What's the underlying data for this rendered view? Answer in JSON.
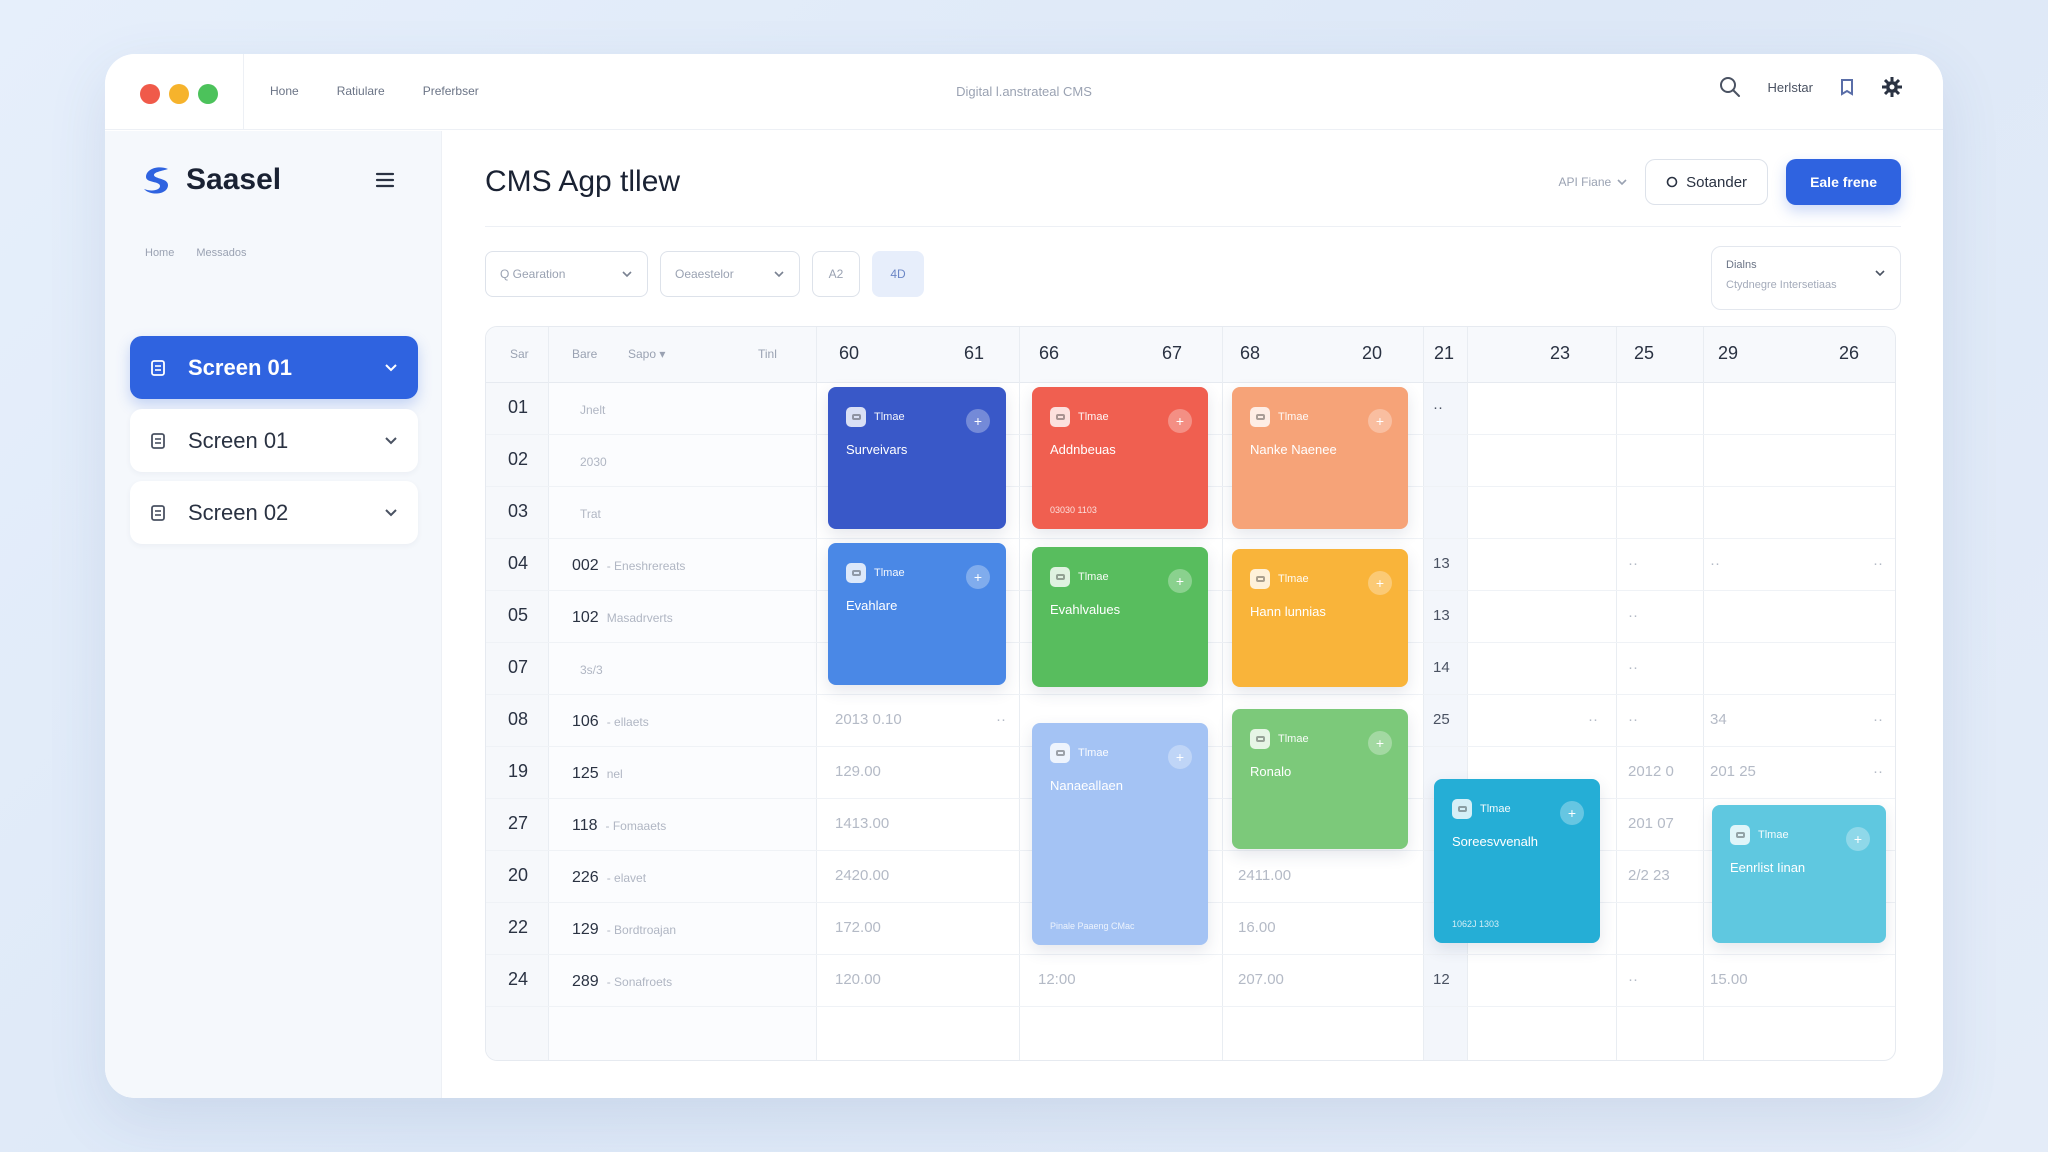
{
  "colors": {
    "accent": "#2f63e0",
    "red": "#f05f50",
    "green": "#58bd5e",
    "orange": "#f6a378",
    "yellow": "#f9b43a",
    "teal": "#25aed6",
    "cyan": "#5fc8e0",
    "light_blue": "#a4c3f4",
    "grass": "#7cc97a"
  },
  "window": {
    "title": "Digital l.anstrateal CMS"
  },
  "topnav": [
    "Hone",
    "Ratiulare",
    "Preferbser"
  ],
  "topbar": {
    "user": "Herlstar",
    "icons": [
      "search-icon",
      "bookmark-icon",
      "settings-gear-icon"
    ]
  },
  "sidebar": {
    "brand": "Saasel",
    "crumbs": [
      "Home",
      "Messados"
    ],
    "items": [
      {
        "label": "Screen 01",
        "active": true
      },
      {
        "label": "Screen 01",
        "active": false
      },
      {
        "label": "Screen 02",
        "active": false
      }
    ]
  },
  "header": {
    "title": "CMS Agp tllew",
    "dropdown_label": "API Fiane",
    "secondary_button": "Sotander",
    "primary_button": "Eale frene"
  },
  "filters": [
    {
      "label": "Q Gearation"
    },
    {
      "label": "Oeaestelor"
    },
    {
      "label": "A2"
    },
    {
      "label": "4D"
    }
  ],
  "view_select": {
    "label": "Dialns",
    "sub": "Ctydnegre Intersetiaas"
  },
  "table": {
    "col_headers": [
      "Sar",
      "Bare",
      "Sapo",
      "Tinl"
    ],
    "date_headers": [
      "60",
      "61",
      "66",
      "67",
      "68",
      "20",
      "21",
      "23",
      "25",
      "29",
      "26"
    ],
    "rows": [
      {
        "n": "01",
        "a": "",
        "b": "Jnelt",
        "c3": "",
        "c5": "",
        "c7": "··",
        "c8": "",
        "c9": "",
        "c10": ""
      },
      {
        "n": "02",
        "a": "",
        "b": "2030",
        "c3": "",
        "c5": "",
        "c7": "",
        "c8": "",
        "c9": "",
        "c10": ""
      },
      {
        "n": "03",
        "a": "",
        "b": "Trat",
        "c3": "",
        "c5": "",
        "c7": "",
        "c8": "",
        "c9": "",
        "c10": ""
      },
      {
        "n": "04",
        "a": "002",
        "b": "- Eneshrereats",
        "c3": "",
        "c5": "",
        "c7": "13",
        "c8": "",
        "c9": "··",
        "c10": "··"
      },
      {
        "n": "05",
        "a": "102",
        "b": "Masadrverts",
        "c3": "",
        "c5": "",
        "c7": "13",
        "c8": "",
        "c9": "··",
        "c10": ""
      },
      {
        "n": "07",
        "a": "",
        "b": "3s/3",
        "c3": "",
        "c5": "",
        "c7": "14",
        "c8": "",
        "c9": "··",
        "c10": ""
      },
      {
        "n": "08",
        "a": "106",
        "b": "- ellaets",
        "c3": "2013 0.10",
        "c5": "",
        "c7": "25",
        "c8": "··",
        "c9": "··",
        "c10": "34"
      },
      {
        "n": "19",
        "a": "125",
        "b": "nel",
        "c3": "129.00",
        "c5": "",
        "c7": "",
        "c8": "",
        "c9": "2012 0",
        "c10": "201 25"
      },
      {
        "n": "27",
        "a": "118",
        "b": "- Fomaaets",
        "c3": "1413.00",
        "c5": "",
        "c7": "",
        "c8": "",
        "c9": "201 07",
        "c10": ""
      },
      {
        "n": "20",
        "a": "226",
        "b": "- elavet",
        "c3": "2420.00",
        "c5": "2411.00",
        "c7": "",
        "c8": "",
        "c9": "2/2 23",
        "c10": ""
      },
      {
        "n": "22",
        "a": "129",
        "b": "- Bordtroajan",
        "c3": "172.00",
        "c5": "16.00",
        "c7": "",
        "c8": "",
        "c9": "",
        "c10": ""
      },
      {
        "n": "24",
        "a": "289",
        "b": "- Sonafroets",
        "c3": "120.00",
        "c4": "12:00",
        "c5": "207.00",
        "c7": "12",
        "c8": "",
        "c9": "··",
        "c10": "15.00"
      }
    ],
    "row_trailing": {
      "r08_c4": "··",
      "r08_c10b": "··",
      "r19_c10b": "··",
      "r04_c10b": "··"
    }
  },
  "cards": [
    {
      "tag": "Tlmae",
      "title": "Surveivars",
      "foot": "",
      "color": "#3958c8"
    },
    {
      "tag": "Tlmae",
      "title": "Addnbeuas",
      "foot": "03030 1103",
      "color": "#f05f50"
    },
    {
      "tag": "Tlmae",
      "title": "Nanke Naenee",
      "foot": "",
      "color": "#f6a378"
    },
    {
      "tag": "Tlmae",
      "title": "Evahlare",
      "foot": "",
      "color": "#4a88e6"
    },
    {
      "tag": "Tlmae",
      "title": "Evahlvalues",
      "foot": "",
      "color": "#58bd5e"
    },
    {
      "tag": "Tlmae",
      "title": "Hann lunnias",
      "foot": "",
      "color": "#f9b43a"
    },
    {
      "tag": "Tlmae",
      "title": "Nanaeallaen",
      "foot": "Pinale Paaeng CMac",
      "color": "#a4c3f4"
    },
    {
      "tag": "Tlmae",
      "title": "Ronalo",
      "foot": "",
      "color": "#7cc97a"
    },
    {
      "tag": "Tlmae",
      "title": "Soreesvvenalh",
      "foot": "1062J 1303",
      "color": "#25aed6"
    },
    {
      "tag": "Tlmae",
      "title": "Eenrlist Iinan",
      "foot": "",
      "color": "#5fc8e0"
    }
  ]
}
